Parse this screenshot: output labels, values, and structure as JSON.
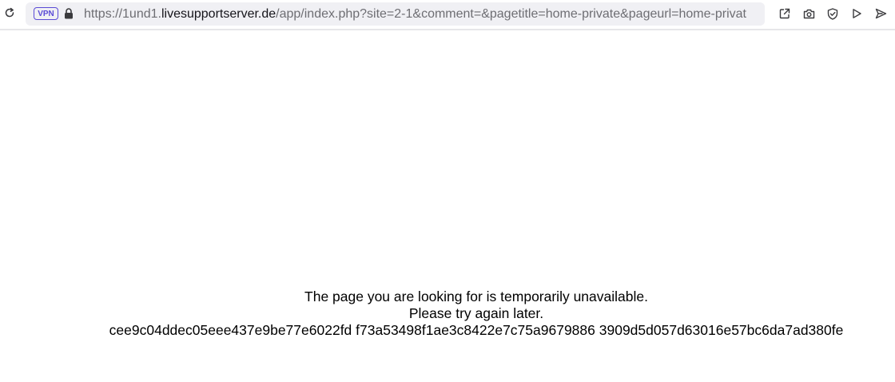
{
  "browser": {
    "address_bar": {
      "vpn_badge": "VPN",
      "url_scheme": "https://",
      "url_subdomain": "1und1.",
      "url_host": "livesupportserver.de",
      "url_path": "/app/index.php?site=2-1&comment=&pagetitle=home-private&pageurl=home-privat"
    },
    "toolbar_icons": [
      "reload-icon",
      "lock-icon",
      "share-icon",
      "camera-icon",
      "shield-icon",
      "play-icon",
      "send-icon"
    ],
    "accent_color": "#5b4bd6"
  },
  "page": {
    "line1": "The page you are looking for is temporarily unavailable.",
    "line2": "Please try again later.",
    "line3": "cee9c04ddec05eee437e9be77e6022fd f73a53498f1ae3c8422e7c75a9679886 3909d5d057d63016e57bc6da7ad380fe"
  }
}
